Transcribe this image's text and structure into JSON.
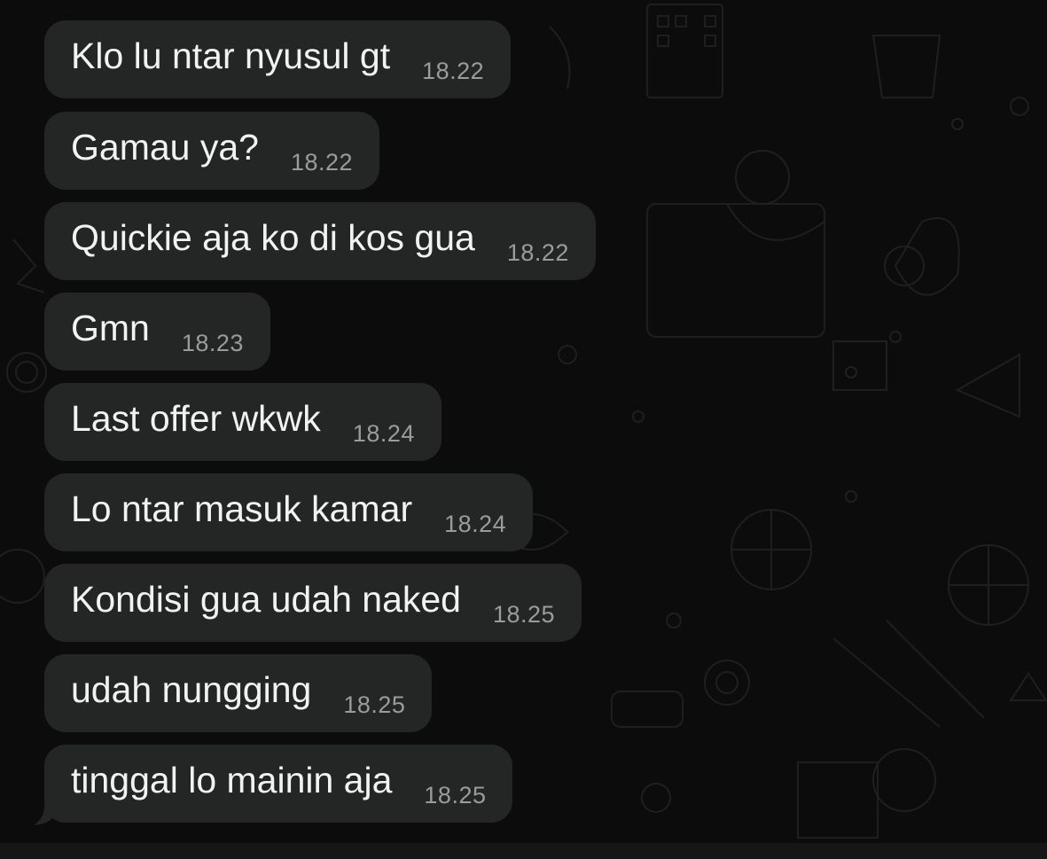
{
  "messages": [
    {
      "text": "Klo lu ntar nyusul gt",
      "time": "18.22"
    },
    {
      "text": "Gamau ya?",
      "time": "18.22"
    },
    {
      "text": "Quickie aja ko di kos gua",
      "time": "18.22"
    },
    {
      "text": "Gmn",
      "time": "18.23"
    },
    {
      "text": "Last offer wkwk",
      "time": "18.24"
    },
    {
      "text": "Lo ntar masuk kamar",
      "time": "18.24"
    },
    {
      "text": "Kondisi gua udah naked",
      "time": "18.25"
    },
    {
      "text": "udah nungging",
      "time": "18.25"
    },
    {
      "text": "tinggal lo mainin aja",
      "time": "18.25"
    }
  ],
  "colors": {
    "background": "#0c0c0c",
    "bubble": "#242626",
    "text": "#f2f2f2",
    "timestamp": "#9a9c9c",
    "doodle": "#2a2a2a"
  },
  "icons": {
    "wallpaper": "chat-doodle-wallpaper",
    "tail": "bubble-tail"
  }
}
